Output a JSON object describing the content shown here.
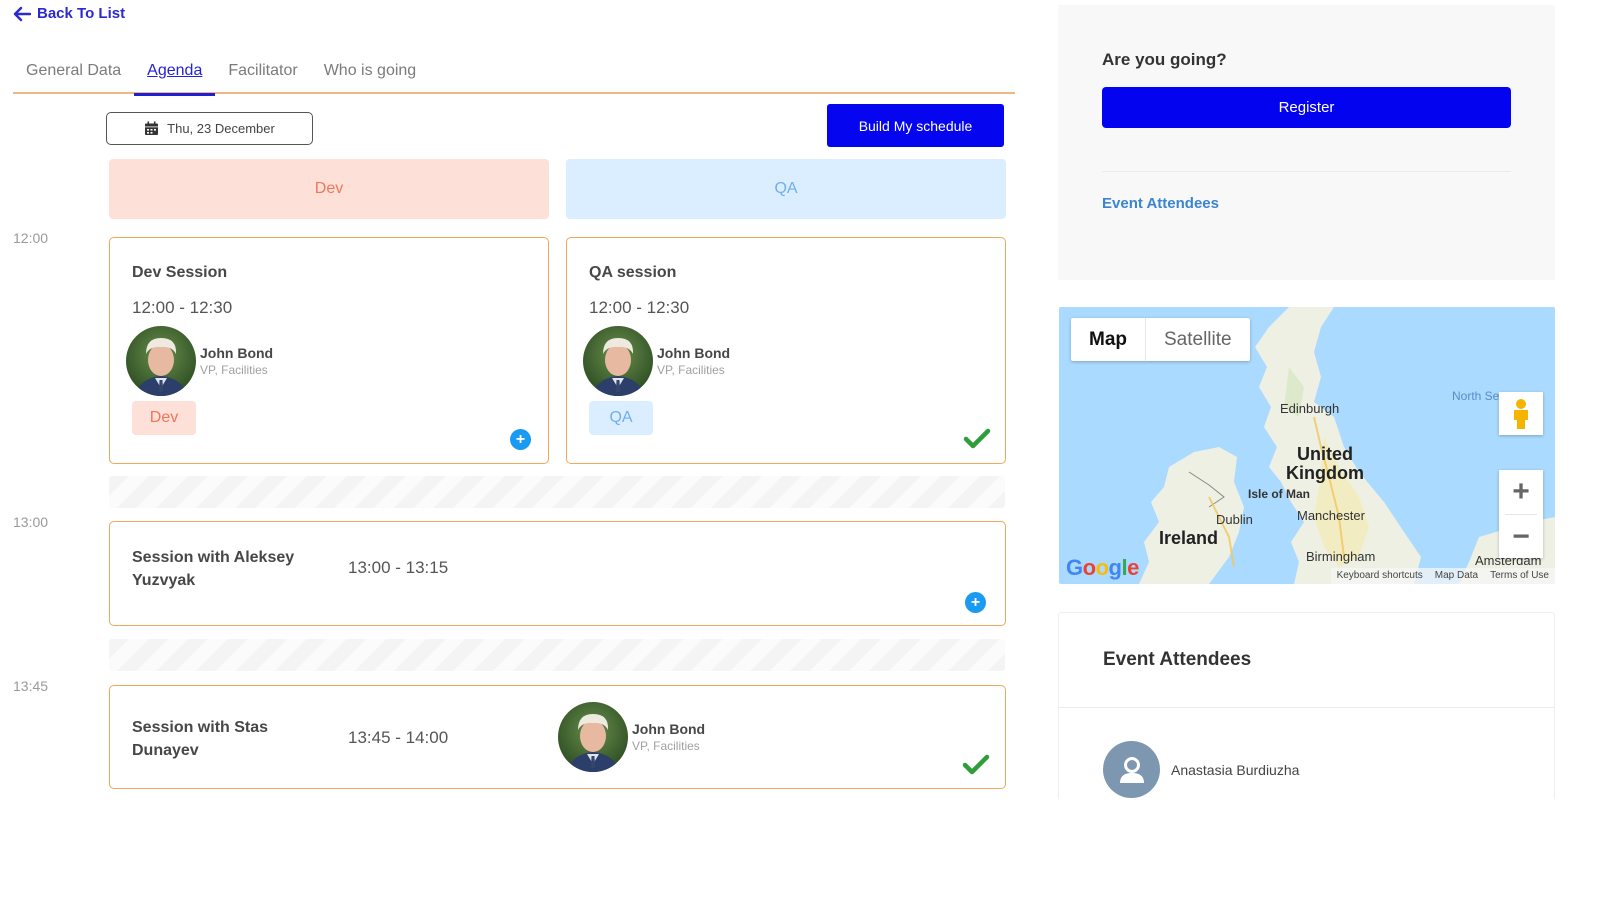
{
  "nav": {
    "back_label": "Back To List"
  },
  "tabs": [
    {
      "label": "General Data",
      "active": false
    },
    {
      "label": "Agenda",
      "active": true
    },
    {
      "label": "Facilitator",
      "active": false
    },
    {
      "label": "Who is going",
      "active": false
    }
  ],
  "agenda": {
    "date": "Thu, 23 December",
    "build_button": "Build My schedule",
    "tracks": [
      "Dev",
      "QA"
    ],
    "time_labels": [
      "12:00",
      "13:00",
      "13:45"
    ],
    "sessions": [
      {
        "title": "Dev Session",
        "time": "12:00 - 12:30",
        "speaker": {
          "name": "John Bond",
          "role": "VP, Facilities"
        },
        "tag": "Dev",
        "status": "add"
      },
      {
        "title": "QA session",
        "time": "12:00 - 12:30",
        "speaker": {
          "name": "John Bond",
          "role": "VP, Facilities"
        },
        "tag": "QA",
        "status": "added"
      },
      {
        "title": "Session with Aleksey Yuzvyak",
        "time": "13:00 - 13:15",
        "status": "add"
      },
      {
        "title": "Session with Stas Dunayev",
        "time": "13:45 - 14:00",
        "speaker": {
          "name": "John Bond",
          "role": "VP, Facilities"
        },
        "status": "added"
      }
    ],
    "colors": {
      "accent_border": "#f0a85a",
      "dev_bg": "#fde0d8",
      "dev_text": "#f0765a",
      "qa_bg": "#dbeeff",
      "qa_text": "#70aef0",
      "primary": "#0505f0",
      "add_icon": "#1a9af0",
      "check": "#2f9e3a"
    }
  },
  "sidebar": {
    "going_title": "Are you going?",
    "register_label": "Register",
    "attendees_link": "Event Attendees"
  },
  "map": {
    "type_options": [
      "Map",
      "Satellite"
    ],
    "selected_type": "Map",
    "labels": {
      "edinburgh": "Edinburgh",
      "uk_line1": "United",
      "uk_line2": "Kingdom",
      "isle_of_man": "Isle of Man",
      "dublin": "Dublin",
      "ireland": "Ireland",
      "manchester": "Manchester",
      "birmingham": "Birmingham",
      "north_sea": "North Se",
      "amsterdam": "Amsterdam"
    },
    "zoom_in": "+",
    "zoom_out": "−",
    "footer": [
      "Keyboard shortcuts",
      "Map Data",
      "Terms of Use"
    ],
    "logo": "Google"
  },
  "attendees": {
    "title": "Event Attendees",
    "list": [
      {
        "name": "Anastasia Burdiuzha"
      }
    ]
  }
}
